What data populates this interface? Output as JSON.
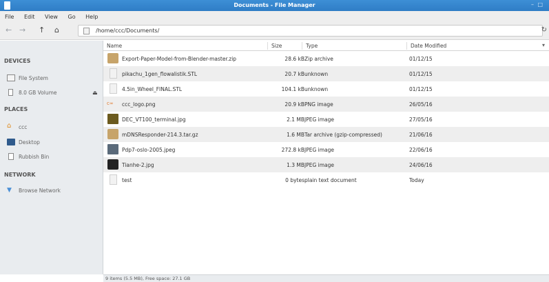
{
  "window": {
    "title": "Documents - File Manager",
    "minimize_glyph": "–",
    "maximize_glyph": "□"
  },
  "menu": [
    "File",
    "Edit",
    "View",
    "Go",
    "Help"
  ],
  "toolbar": {
    "back_icon": "←",
    "forward_icon": "→",
    "up_icon": "↑",
    "home_icon": "⌂",
    "path": "/home/ccc/Documents/",
    "reload_icon": "↻"
  },
  "sidebar": {
    "devices_heading": "DEVICES",
    "devices": [
      "File System",
      "8.0 GB Volume"
    ],
    "eject_glyph": "⏏",
    "places_heading": "PLACES",
    "places": [
      "ccc",
      "Desktop",
      "Rubbish Bin"
    ],
    "network_heading": "NETWORK",
    "network": [
      "Browse Network"
    ]
  },
  "columns": {
    "name": "Name",
    "size": "Size",
    "type": "Type",
    "date": "Date Modified",
    "sort_glyph": "▾"
  },
  "files": [
    {
      "name": "Export-Paper-Model-from-Blender-master.zip",
      "size": "28.6 kB",
      "type": "Zip archive",
      "date": "01/12/15",
      "icon": "archive-icon"
    },
    {
      "name": "pikachu_1gen_flowalistik.STL",
      "size": "20.7 kB",
      "type": "unknown",
      "date": "01/12/15",
      "icon": "document-icon"
    },
    {
      "name": "4.5in_Wheel_FINAL.STL",
      "size": "104.1 kB",
      "type": "unknown",
      "date": "01/12/15",
      "icon": "document-icon"
    },
    {
      "name": "ccc_logo.png",
      "size": "20.9 kB",
      "type": "PNG image",
      "date": "26/05/16",
      "icon": "image-icon",
      "icon_glyph": "c∞"
    },
    {
      "name": "DEC_VT100_terminal.jpg",
      "size": "2.1 MB",
      "type": "JPEG image",
      "date": "27/05/16",
      "icon": "thumbnail-icon"
    },
    {
      "name": "mDNSResponder-214.3.tar.gz",
      "size": "1.6 MB",
      "type": "Tar archive (gzip-compressed)",
      "date": "21/06/16",
      "icon": "archive-icon"
    },
    {
      "name": "Pdp7-oslo-2005.jpeg",
      "size": "272.8 kB",
      "type": "JPEG image",
      "date": "22/06/16",
      "icon": "thumbnail-icon"
    },
    {
      "name": "Tianhe-2.jpg",
      "size": "1.3 MB",
      "type": "JPEG image",
      "date": "24/06/16",
      "icon": "thumbnail-icon"
    },
    {
      "name": "test",
      "size": "0 bytes",
      "type": "plain text document",
      "date": "Today",
      "icon": "document-icon"
    }
  ],
  "status": "9 items (5.5 MB), Free space: 27.1 GB",
  "colors": {
    "titlebar": "#2f7dc6",
    "sidebar": "#e9ecef",
    "alt_row": "#eeeeee"
  }
}
